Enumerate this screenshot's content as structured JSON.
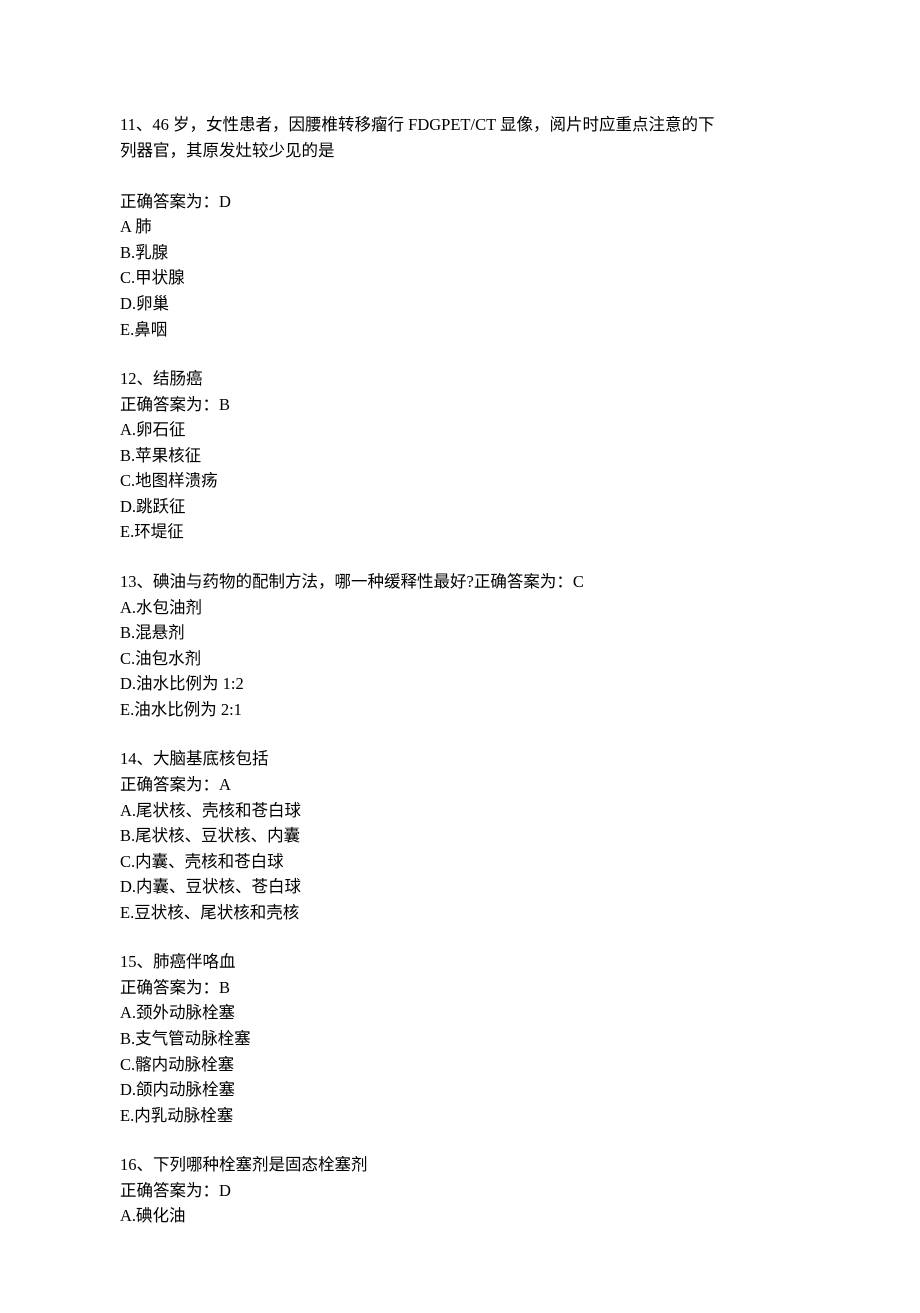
{
  "questions": [
    {
      "number": "11、",
      "text_line1": "46 岁，女性患者，因腰椎转移瘤行 FDGPET/CT 显像，阅片时应重点注意的下",
      "text_line2": "列器官，其原发灶较少见的是",
      "blank_after_stem": true,
      "answer": "正确答案为：D",
      "options": [
        "A 肺",
        "B.乳腺",
        "C.甲状腺",
        "D.卵巢",
        "E.鼻咽"
      ]
    },
    {
      "number": "12、",
      "text_line1": "结肠癌",
      "answer": "正确答案为：B",
      "options": [
        "A.卵石征",
        "B.苹果核征",
        "C.地图样溃疡",
        "D.跳跃征",
        "E.环堤征"
      ]
    },
    {
      "number": "13、",
      "text_line1": "碘油与药物的配制方法，哪一种缓释性最好?正确答案为：C",
      "options": [
        "A.水包油剂",
        "B.混悬剂",
        "C.油包水剂",
        "D.油水比例为 1:2",
        "E.油水比例为 2:1"
      ]
    },
    {
      "number": "14、",
      "text_line1": "大脑基底核包括",
      "answer": "正确答案为：A",
      "options": [
        "A.尾状核、壳核和苍白球",
        "B.尾状核、豆状核、内囊",
        "C.内囊、壳核和苍白球",
        "D.内囊、豆状核、苍白球",
        "E.豆状核、尾状核和壳核"
      ]
    },
    {
      "number": "15、",
      "text_line1": "肺癌伴咯血",
      "answer": "正确答案为：B",
      "options": [
        "A.颈外动脉栓塞",
        "B.支气管动脉栓塞",
        "C.髂内动脉栓塞",
        "D.颌内动脉栓塞",
        "E.内乳动脉栓塞"
      ]
    },
    {
      "number": "16、",
      "text_line1": "下列哪种栓塞剂是固态栓塞剂",
      "answer": "正确答案为：D",
      "options": [
        "A.碘化油"
      ]
    }
  ]
}
